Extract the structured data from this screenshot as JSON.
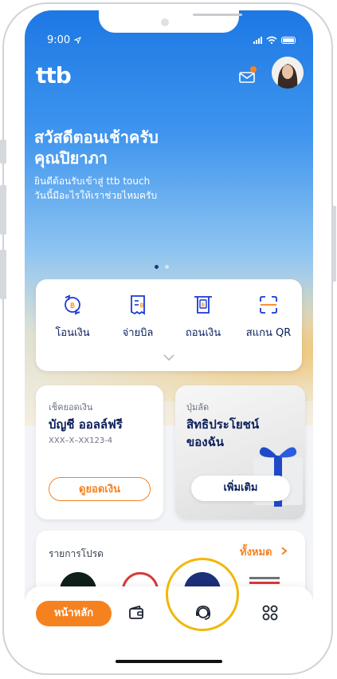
{
  "status": {
    "time": "9:00"
  },
  "brand": {
    "logo": "ttb",
    "accent": "#f5821f",
    "navy": "#0b1f5c"
  },
  "hero": {
    "greeting_line1": "สวัสดีตอนเช้าครับ",
    "greeting_line2": "คุณปิยาภา",
    "sub_line1": "ยินดีต้อนรับเข้าสู่ ttb touch",
    "sub_line2": "วันนี้มีอะไรให้เราช่วยไหมครับ"
  },
  "quick_actions": [
    {
      "label": "โอนเงิน",
      "icon": "transfer-icon"
    },
    {
      "label": "จ่ายบิล",
      "icon": "bill-icon"
    },
    {
      "label": "ถอนเงิน",
      "icon": "withdraw-icon"
    },
    {
      "label": "สแกน QR",
      "icon": "scan-qr-icon"
    }
  ],
  "balance_card": {
    "caption": "เช็คยอดเงิน",
    "account_name": "บัญชี ออลล์ฟรี",
    "account_number": "XXX–X–XX123-4",
    "button": "ดูยอดเงิน"
  },
  "privilege_card": {
    "caption": "ปุ่มลัด",
    "title_line1": "สิทธิประโยชน์",
    "title_line2": "ของฉัน",
    "button": "เพิ่มเติม"
  },
  "promo": {
    "title": "รายการโปรด",
    "see_all": "ทั้งหมด"
  },
  "bottom_nav": {
    "home_label": "หน้าหลัก",
    "icons": [
      "wallet-icon",
      "support-agent-icon",
      "menu-grid-icon"
    ]
  }
}
